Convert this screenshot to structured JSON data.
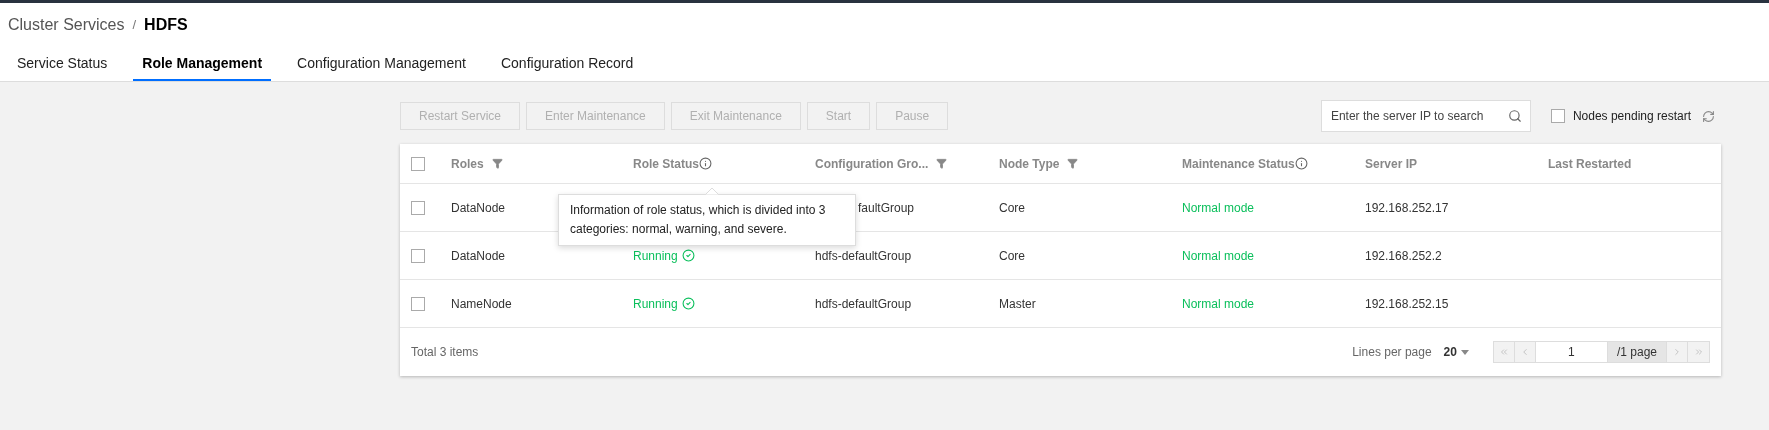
{
  "breadcrumb": {
    "parent": "Cluster Services",
    "separator": "/",
    "current": "HDFS"
  },
  "tabs": [
    {
      "label": "Service Status",
      "selected": false
    },
    {
      "label": "Role Management",
      "selected": true
    },
    {
      "label": "Configuration Management",
      "selected": false
    },
    {
      "label": "Configuration Record",
      "selected": false
    }
  ],
  "toolbar": {
    "buttons": [
      {
        "label": "Restart Service",
        "disabled": true
      },
      {
        "label": "Enter Maintenance",
        "disabled": true
      },
      {
        "label": "Exit Maintenance",
        "disabled": true
      },
      {
        "label": "Start",
        "disabled": true
      },
      {
        "label": "Pause",
        "disabled": true
      }
    ],
    "search": {
      "placeholder": "Enter the server IP to search"
    },
    "pending_restart": {
      "label": "Nodes pending restart",
      "checked": false
    }
  },
  "table": {
    "select_all": {
      "checked": false
    },
    "columns": [
      {
        "label": "Roles",
        "kind": "filter"
      },
      {
        "label": "Role Status",
        "kind": "info"
      },
      {
        "label": "Configuration Gro...",
        "kind": "filter"
      },
      {
        "label": "Node Type",
        "kind": "filter"
      },
      {
        "label": "Maintenance Status",
        "kind": "info"
      },
      {
        "label": "Server IP",
        "kind": "plain"
      },
      {
        "label": "Last Restarted",
        "kind": "plain"
      }
    ],
    "rows": [
      {
        "checked": false,
        "role": "DataNode",
        "config_group": "faultGroup",
        "covered": true,
        "node_type": "Core",
        "maintenance": "Normal mode",
        "server_ip": "192.168.252.17"
      },
      {
        "checked": false,
        "role": "DataNode",
        "status": {
          "text": "Running",
          "kind": "running"
        },
        "config_group": "hdfs-defaultGroup",
        "node_type": "Core",
        "maintenance": "Normal mode",
        "server_ip": "192.168.252.2"
      },
      {
        "checked": false,
        "role": "NameNode",
        "status": {
          "text": "Running",
          "kind": "running"
        },
        "config_group": "hdfs-defaultGroup",
        "node_type": "Master",
        "maintenance": "Normal mode",
        "server_ip": "192.168.252.15"
      }
    ]
  },
  "tooltip": {
    "text": "Information of role status, which is divided into 3 categories: normal, warning, and severe."
  },
  "footer": {
    "total": "Total 3 items",
    "lines_label": "Lines per page",
    "page_size": "20",
    "page": "1",
    "page_total": "/1 page"
  }
}
